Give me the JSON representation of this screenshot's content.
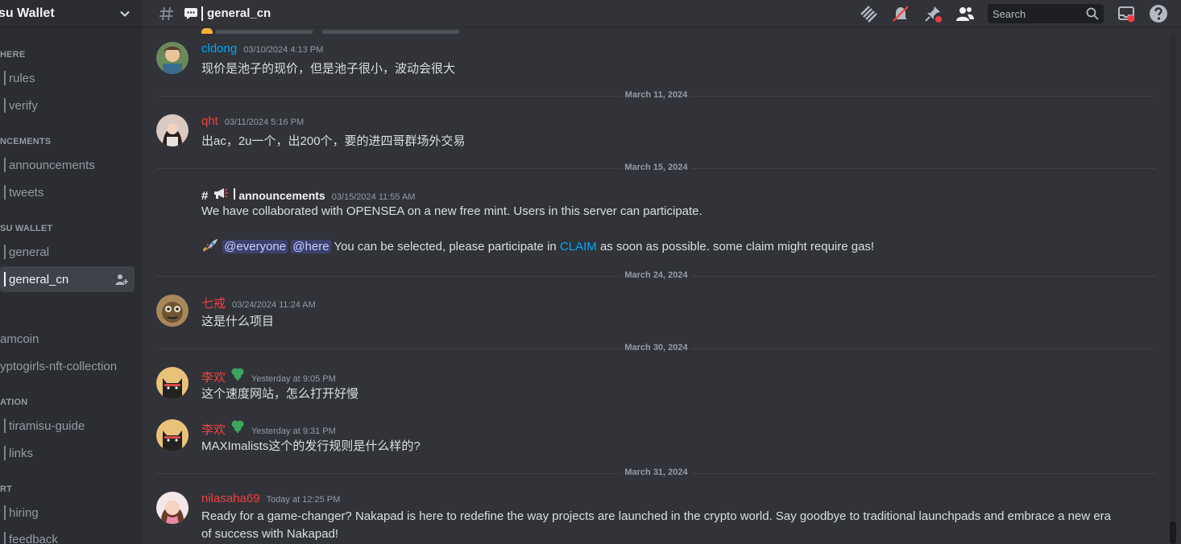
{
  "sidebar": {
    "server_name": "su Wallet",
    "categories": [
      {
        "label": "HERE",
        "channels": [
          {
            "name": "rules"
          },
          {
            "name": "verify"
          }
        ]
      },
      {
        "label": "NCEMENTS",
        "channels": [
          {
            "name": "announcements"
          },
          {
            "name": "tweets"
          }
        ]
      },
      {
        "label": "SU WALLET",
        "channels": [
          {
            "name": "general"
          },
          {
            "name": "general_cn"
          }
        ]
      },
      {
        "label": "",
        "channels": [
          {
            "name": "amcoin"
          },
          {
            "name": "yptogirls-nft-collection"
          }
        ]
      },
      {
        "label": "ATION",
        "channels": [
          {
            "name": "tiramisu-guide"
          },
          {
            "name": "links"
          }
        ]
      },
      {
        "label": "RT",
        "channels": [
          {
            "name": "hiring"
          },
          {
            "name": "feedback"
          }
        ]
      }
    ]
  },
  "header": {
    "channel_name": "general_cn",
    "search_placeholder": "Search"
  },
  "messages": [
    {
      "author": "cldong",
      "author_color": "#00a8fc",
      "timestamp": "03/10/2024 4:13 PM",
      "text": "现价是池子的现价，但是池子很小，波动会很大"
    },
    {
      "divider": "March 11, 2024"
    },
    {
      "author": "qht",
      "author_color": "#f23f42",
      "timestamp": "03/11/2024 5:16 PM",
      "text": "出ac，2u一个，出200个，要的进四哥群场外交易"
    },
    {
      "divider": "March 15, 2024"
    },
    {
      "author": "announcements",
      "author_prefix": "#",
      "timestamp": "03/15/2024 11:55 AM",
      "text": "We have collaborated with OPENSEA on a new free mint. Users in this server can participate.",
      "line2": {
        "mention1": "@everyone",
        "mention2": "@here",
        "before_link": "You can be selected, please participate in",
        "link": "CLAIM",
        "after_link": "as soon as possible. some claim might require gas!"
      }
    },
    {
      "divider": "March 24, 2024"
    },
    {
      "author": "七戒",
      "author_color": "#f23f42",
      "timestamp": "03/24/2024 11:24 AM",
      "text": "这是什么项目"
    },
    {
      "divider": "March 30, 2024"
    },
    {
      "author": "李欢",
      "author_color": "#f23f42",
      "timestamp": "Yesterday at 9:05 PM",
      "text": "这个速度网站，怎么打开好慢"
    },
    {
      "author": "李欢",
      "author_color": "#f23f42",
      "timestamp": "Yesterday at 9:31 PM",
      "text": "MAXImalists这个的发行规则是什么样的?"
    },
    {
      "divider": "March 31, 2024"
    },
    {
      "author": "nilasaha69",
      "author_color": "#f23f42",
      "timestamp": "Today at 12:25 PM",
      "text": "Ready for a game-changer? Nakapad is here to redefine the way projects are launched in the crypto world. Say goodbye to traditional launchpads and embrace a new era",
      "text2": "of success with Nakapad!"
    }
  ]
}
